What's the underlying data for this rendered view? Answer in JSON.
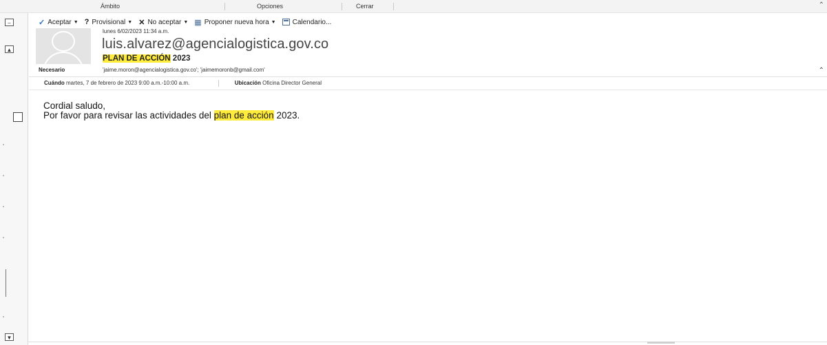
{
  "ribbon": {
    "groups": [
      "Ámbito",
      "Opciones",
      "Cerrar"
    ],
    "collapse_icon": "chevron-up-icon"
  },
  "toolbar": {
    "accept": "Aceptar",
    "tentative": "Provisional",
    "decline": "No aceptar",
    "propose": "Proponer nueva hora",
    "calendar": "Calendario..."
  },
  "message": {
    "date": "lunes 6/02/2023 11:34 a.m.",
    "sender": "luis.alvarez@agencialogistica.gov.co",
    "subject_highlight": "PLAN DE ACCIÓN",
    "subject_rest": " 2023",
    "required_label": "Necesario",
    "required_value": "'jaime.moron@agencialogistica.gov.co'; 'jaimemoronb@gmail.com'",
    "when_label": "Cuándo",
    "when_value": "martes, 7 de febrero de 2023 9:00 a.m.-10:00 a.m.",
    "location_label": "Ubicación",
    "location_value": "Oficina Director General"
  },
  "body": {
    "greeting": "Cordial saludo,",
    "line_prefix": "Por favor para revisar las actividades del ",
    "line_highlight": "plan de acción",
    "line_suffix": " 2023."
  },
  "colors": {
    "highlight": "#ffeb3b",
    "accept_check": "#2b6fbf"
  }
}
